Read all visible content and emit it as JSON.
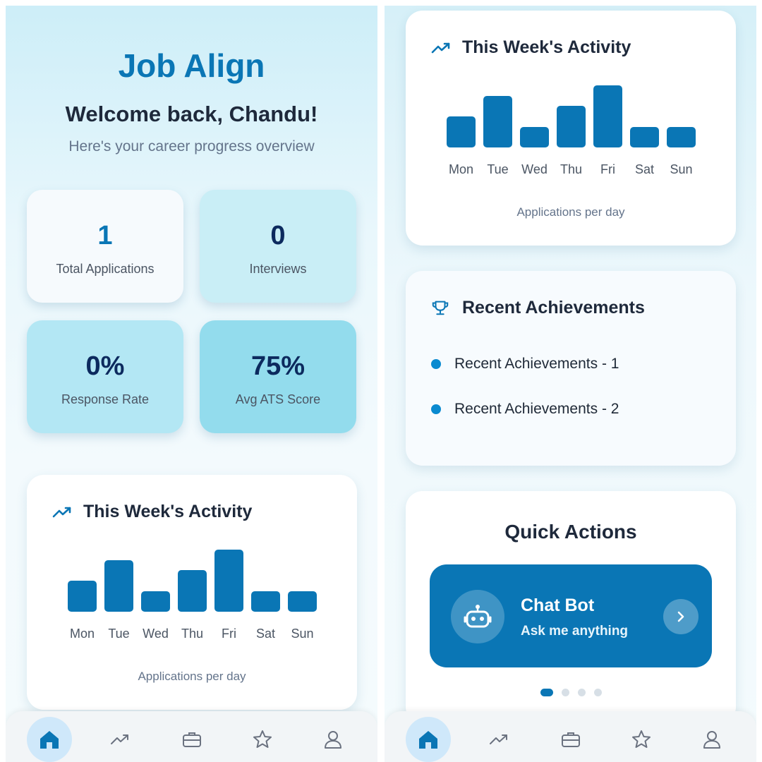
{
  "app": {
    "title": "Job Align"
  },
  "welcome": {
    "heading": "Welcome back, Chandu!",
    "subtitle": "Here's your career progress overview"
  },
  "stats": [
    {
      "value": "1",
      "label": "Total Applications"
    },
    {
      "value": "0",
      "label": "Interviews"
    },
    {
      "value": "0%",
      "label": "Response Rate"
    },
    {
      "value": "75%",
      "label": "Avg ATS Score"
    }
  ],
  "activity": {
    "title": "This Week's Activity",
    "caption": "Applications per day",
    "icon": "trending-up-icon"
  },
  "chart_data": {
    "type": "bar",
    "categories": [
      "Mon",
      "Tue",
      "Wed",
      "Thu",
      "Fri",
      "Sat",
      "Sun"
    ],
    "values": [
      3,
      5,
      2,
      4,
      6,
      2,
      2
    ],
    "title": "This Week's Activity",
    "xlabel": "Applications per day",
    "ylabel": "",
    "grid": false
  },
  "achievements": {
    "title": "Recent Achievements",
    "icon": "trophy-icon",
    "items": [
      "Recent Achievements - 1",
      "Recent Achievements - 2"
    ]
  },
  "quick_actions": {
    "title": "Quick Actions",
    "chatbot": {
      "title": "Chat Bot",
      "subtitle": "Ask me anything",
      "icon": "robot-icon"
    },
    "carousel": {
      "count": 4,
      "active": 0
    }
  },
  "nav": {
    "items": [
      "home-icon",
      "trending-up-icon",
      "briefcase-icon",
      "star-icon",
      "user-icon"
    ],
    "active": 0
  },
  "colors": {
    "accent": "#0a76b5",
    "background": "#e9f7fc"
  }
}
